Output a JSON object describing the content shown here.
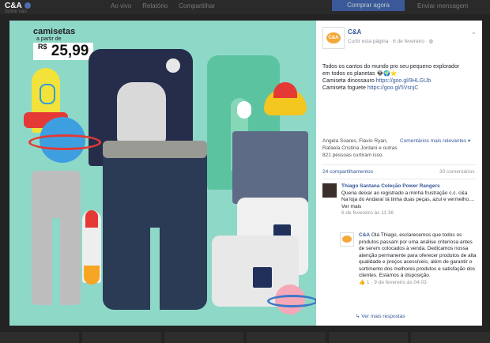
{
  "topbar": {
    "page_name": "C&A",
    "subtitle": "Sobre não",
    "menu": [
      "Ao vivo",
      "Relatório",
      "Compartilhar"
    ],
    "buy_button": "Comprar agora",
    "more": "Enviar mensagem"
  },
  "photo": {
    "cta_line1": "camisetas",
    "cta_line2": "a partir de",
    "price_currency": "R$",
    "price_value": "25,99"
  },
  "post": {
    "page_name": "C&A",
    "meta": "Curtir esta página · 6 de fevereiro · ",
    "text_line1": "Todos os cantos do mundo pro seu pequeno explorador",
    "text_line2": "em todos os planetas",
    "text_line3_prefix": "Camiseta dinossauro ",
    "text_line3_link": "https://goo.gl/9HLGUb",
    "text_line4_prefix": "Camiseta foguete ",
    "text_line4_link": "https://goo.gl/5VsnjC",
    "reactors": "Angela Soares, Flavio Ryan, Rafaela Cristina Jordani e outras 821 pessoas curtiram isso.",
    "sort_label": "Comentários mais relevantes",
    "shares": "24 compartilhamentos",
    "comments_count": "30 comentários"
  },
  "comments": [
    {
      "author": "Thiago Santana Coleção Power Rangers",
      "text": "Queria deixar ao registrado a minha frustração c.c. c&a",
      "text2": "Na loja do Andaraí tá tinha duas peças, azul e vermelho.... Ver mais",
      "meta": "6 de fevereiro às 11:36"
    },
    {
      "author": "C&A",
      "text": "Olá Thiago, esclarecemos que todos os produtos passam por uma análise criteriosa antes de serem colocados à venda. Dedicamos nossa atenção permanente para oferecer produtos de alta qualidade e preços acessíveis, além de garantir o sortimento dos melhores produtos e satisfação dos clientes. Estamos à disposição.",
      "meta": "1 · 9 de fevereiro às 04:03"
    }
  ],
  "reply_link": "Ver mais respostas"
}
